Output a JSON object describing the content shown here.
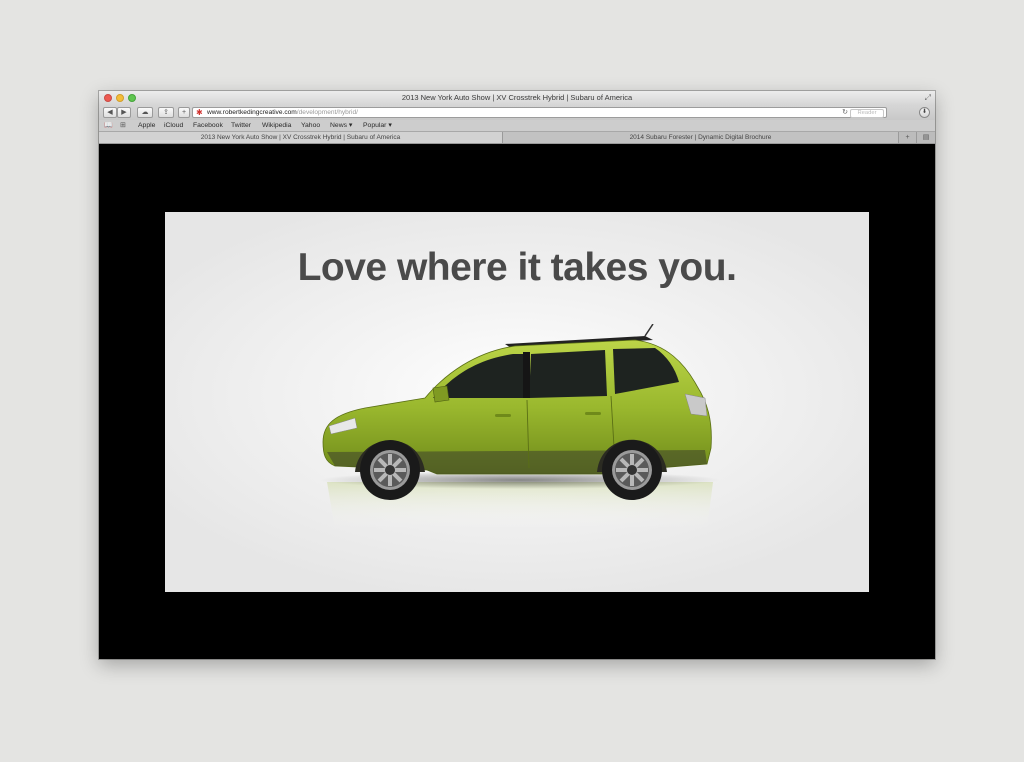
{
  "window": {
    "title": "2013 New York Auto Show | XV Crosstrek Hybrid | Subaru of America"
  },
  "toolbar": {
    "back_label": "◀",
    "forward_label": "▶",
    "icloud_icon": "☁",
    "share_icon": "⇪",
    "add_icon": "+",
    "url_host": "www.robertkedingcreative.com",
    "url_path": "/development/hybrid/",
    "reload_icon": "↻",
    "reader_label": "Reader",
    "download_icon": "⬇"
  },
  "bookmarks": {
    "items": [
      "Apple",
      "iCloud",
      "Facebook",
      "Twitter",
      "Wikipedia",
      "Yahoo",
      "News ▾",
      "Popular ▾"
    ]
  },
  "tabs": [
    {
      "label": "2013 New York Auto Show | XV Crosstrek Hybrid | Subaru of America",
      "active": true
    },
    {
      "label": "2014 Subaru Forester | Dynamic Digital Brochure",
      "active": false
    }
  ],
  "tab_add_icon": "+",
  "tab_overview_icon": "▤",
  "hero": {
    "headline": "Love where it takes you."
  },
  "colors": {
    "car_body": "#9ab82e",
    "headline": "#4a4a4a",
    "page_bg": "#000000"
  }
}
